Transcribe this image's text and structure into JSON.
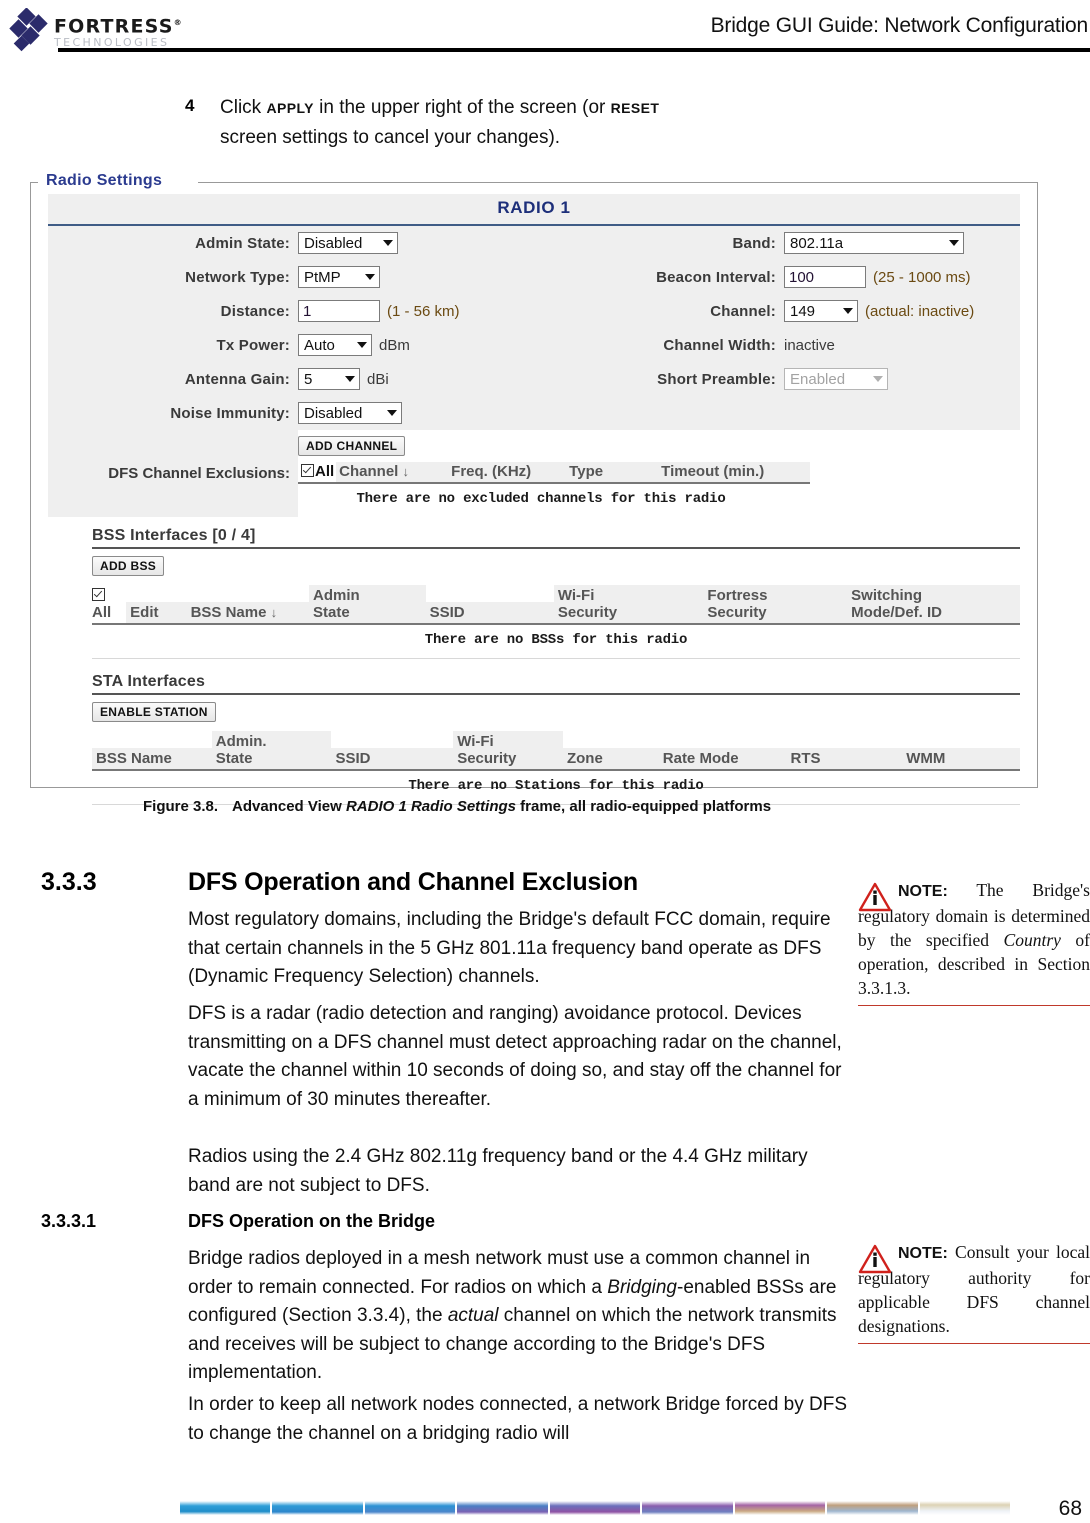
{
  "header": {
    "logo_primary": "FORTRESS",
    "logo_secondary": "TECHNOLOGIES",
    "title": "Bridge GUI Guide: Network Configuration"
  },
  "step": {
    "number": "4",
    "line1_a": "Click ",
    "line1_kbd1": "APPLY",
    "line1_b": " in the upper right of the screen (or ",
    "line1_kbd2": "RESET",
    "line2": "screen settings to cancel your changes)."
  },
  "radio_frame": {
    "legend": "Radio Settings",
    "title": "RADIO 1",
    "left_fields": [
      {
        "label": "Admin State:",
        "control": "select",
        "value": "Disabled",
        "suffix": ""
      },
      {
        "label": "Network Type:",
        "control": "select",
        "value": "PtMP",
        "suffix": ""
      },
      {
        "label": "Distance:",
        "control": "text",
        "value": "1",
        "suffix": "(1 - 56 km)"
      },
      {
        "label": "Tx Power:",
        "control": "select",
        "value": "Auto",
        "suffix": "dBm"
      },
      {
        "label": "Antenna Gain:",
        "control": "select",
        "value": "5",
        "suffix": "dBi"
      },
      {
        "label": "Noise Immunity:",
        "control": "select",
        "value": "Disabled",
        "suffix": ""
      }
    ],
    "right_fields": [
      {
        "label": "Band:",
        "control": "select",
        "value": "802.11a",
        "suffix": ""
      },
      {
        "label": "Beacon Interval:",
        "control": "text",
        "value": "100",
        "suffix": "(25 - 1000 ms)"
      },
      {
        "label": "Channel:",
        "control": "select",
        "value": "149",
        "suffix": "(actual: inactive)"
      },
      {
        "label": "Channel Width:",
        "control": "static",
        "value": "inactive",
        "suffix": ""
      },
      {
        "label": "Short Preamble:",
        "control": "select-disabled",
        "value": "Enabled",
        "suffix": ""
      }
    ],
    "dfs": {
      "label": "DFS Channel Exclusions:",
      "add_button": "ADD CHANNEL",
      "select_all": "All",
      "columns": [
        "Channel",
        "Freq. (KHz)",
        "Type",
        "Timeout (min.)"
      ],
      "empty_message": "There are no excluded channels for this radio"
    },
    "bss": {
      "title": "BSS Interfaces [0 / 4]",
      "add_button": "ADD BSS",
      "select_all": "All",
      "columns": [
        "Edit",
        "BSS Name",
        "Admin\nState",
        "SSID",
        "Wi-Fi\nSecurity",
        "Fortress\nSecurity",
        "Switching\nMode/Def. ID"
      ],
      "empty_message": "There are no BSSs for this radio"
    },
    "sta": {
      "title": "STA Interfaces",
      "enable_button": "ENABLE STATION",
      "columns": [
        "BSS Name",
        "Admin.\nState",
        "SSID",
        "Wi-Fi\nSecurity",
        "Zone",
        "Rate Mode",
        "RTS",
        "WMM"
      ],
      "empty_message": "There are no Stations for this radio"
    }
  },
  "figure_caption": {
    "label": "Figure 3.8.",
    "text_a": "Advanced View ",
    "text_italic": "RADIO 1 Radio Settings",
    "text_b": " frame, all radio-equipped platforms"
  },
  "section_333": {
    "number": "3.3.3",
    "title": "DFS Operation and Channel Exclusion",
    "p1": "Most regulatory domains, including the Bridge's default FCC domain, require that certain channels in the 5 GHz 801.11a frequency band operate as DFS (Dynamic Frequency Selection) channels.",
    "p2": "DFS is a radar (radio detection and ranging) avoidance protocol. Devices transmitting on a DFS channel must detect approaching radar on the channel, vacate the channel within 10 seconds of doing so, and stay off the channel for a minimum of 30 minutes thereafter.",
    "p3": "Radios using the 2.4 GHz 802.11g frequency band or the 4.4 GHz military band are not subject to DFS."
  },
  "section_3331": {
    "number": "3.3.3.1",
    "title": "DFS Operation on the Bridge",
    "p1_a": "Bridge radios deployed in a mesh network must use a common channel in order to remain connected. For radios on which a ",
    "p1_i1": "Bridging",
    "p1_b": "-enabled BSSs are configured (Section 3.3.4), the ",
    "p1_i2": "actual",
    "p1_c": " channel on which the network transmits and receives will be subject to change according to the Bridge's DFS implementation.",
    "p2": "In order to keep all network nodes connected, a network Bridge forced by DFS to change the channel on a bridging radio will"
  },
  "note1": {
    "label": "NOTE:",
    "text_a": "The Bridge's regulatory domain is determined by the specified ",
    "text_italic": "Country",
    "text_b": " of operation, described in Section 3.3.1.3."
  },
  "note2": {
    "label": "NOTE:",
    "text_a": "Consult your local regulatory authority for applicable DFS channel designations."
  },
  "footer": {
    "page_number": "68",
    "bar_colors": [
      "#2f9fd8",
      "#2e9ad6",
      "#2d92d4",
      "#4a7fc4",
      "#6b6fbb",
      "#8a5fae",
      "#a566a6",
      "#c0a07e",
      "#d9c89a"
    ]
  },
  "colors": {
    "legend_blue": "#2b3b8f",
    "title_blue": "#1d2f7a",
    "note_red": "#c0392b",
    "field_shade": "#efefef"
  }
}
